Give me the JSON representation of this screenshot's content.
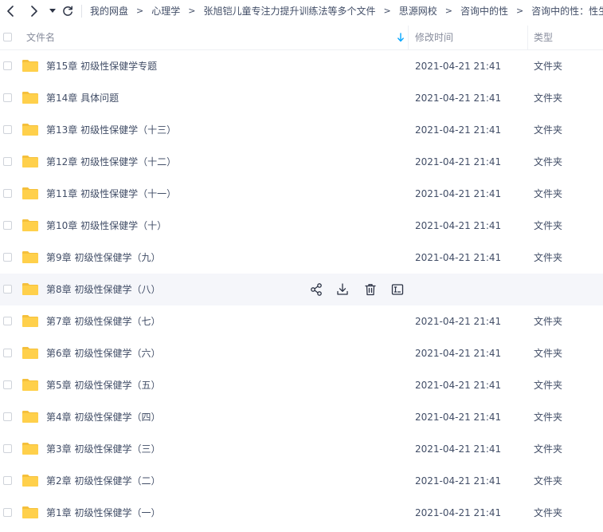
{
  "breadcrumb": [
    "我的网盘",
    "心理学",
    "张旭铠儿童专注力提升训练法等多个文件",
    "思源网校",
    "咨询中的性",
    "咨询中的性：性生理"
  ],
  "breadcrumb_separator": ">",
  "columns": {
    "name": "文件名",
    "modified": "修改时间",
    "type": "类型"
  },
  "files": [
    {
      "name": "第15章 初级性保健学专题",
      "modified": "2021-04-21 21:41",
      "type": "文件夹"
    },
    {
      "name": "第14章 具体问题",
      "modified": "2021-04-21 21:41",
      "type": "文件夹"
    },
    {
      "name": "第13章 初级性保健学（十三）",
      "modified": "2021-04-21 21:41",
      "type": "文件夹"
    },
    {
      "name": "第12章 初级性保健学（十二）",
      "modified": "2021-04-21 21:41",
      "type": "文件夹"
    },
    {
      "name": "第11章 初级性保健学（十一）",
      "modified": "2021-04-21 21:41",
      "type": "文件夹"
    },
    {
      "name": "第10章 初级性保健学（十）",
      "modified": "2021-04-21 21:41",
      "type": "文件夹"
    },
    {
      "name": "第9章 初级性保健学（九）",
      "modified": "2021-04-21 21:41",
      "type": "文件夹"
    },
    {
      "name": "第8章 初级性保健学（八）",
      "modified": "",
      "type": "",
      "hover": true
    },
    {
      "name": "第7章 初级性保健学（七）",
      "modified": "2021-04-21 21:41",
      "type": "文件夹"
    },
    {
      "name": "第6章 初级性保健学（六）",
      "modified": "2021-04-21 21:41",
      "type": "文件夹"
    },
    {
      "name": "第5章 初级性保健学（五）",
      "modified": "2021-04-21 21:41",
      "type": "文件夹"
    },
    {
      "name": "第4章 初级性保健学（四）",
      "modified": "2021-04-21 21:41",
      "type": "文件夹"
    },
    {
      "name": "第3章 初级性保健学（三）",
      "modified": "2021-04-21 21:41",
      "type": "文件夹"
    },
    {
      "name": "第2章 初级性保健学（二）",
      "modified": "2021-04-21 21:41",
      "type": "文件夹"
    },
    {
      "name": "第1章 初级性保健学（一）",
      "modified": "2021-04-21 21:41",
      "type": "文件夹"
    }
  ],
  "icons": {
    "folder": "folder-icon",
    "share": "share-icon",
    "download": "download-icon",
    "delete": "trash-icon",
    "rename": "rename-icon",
    "sort": "sort-down-icon"
  },
  "colors": {
    "folder": "#ffd04b",
    "folder_dark": "#f5c03c",
    "text": "#424e67",
    "header_text": "#878c9c",
    "accent": "#06a7ff",
    "hover_row": "#f5f6fa"
  }
}
